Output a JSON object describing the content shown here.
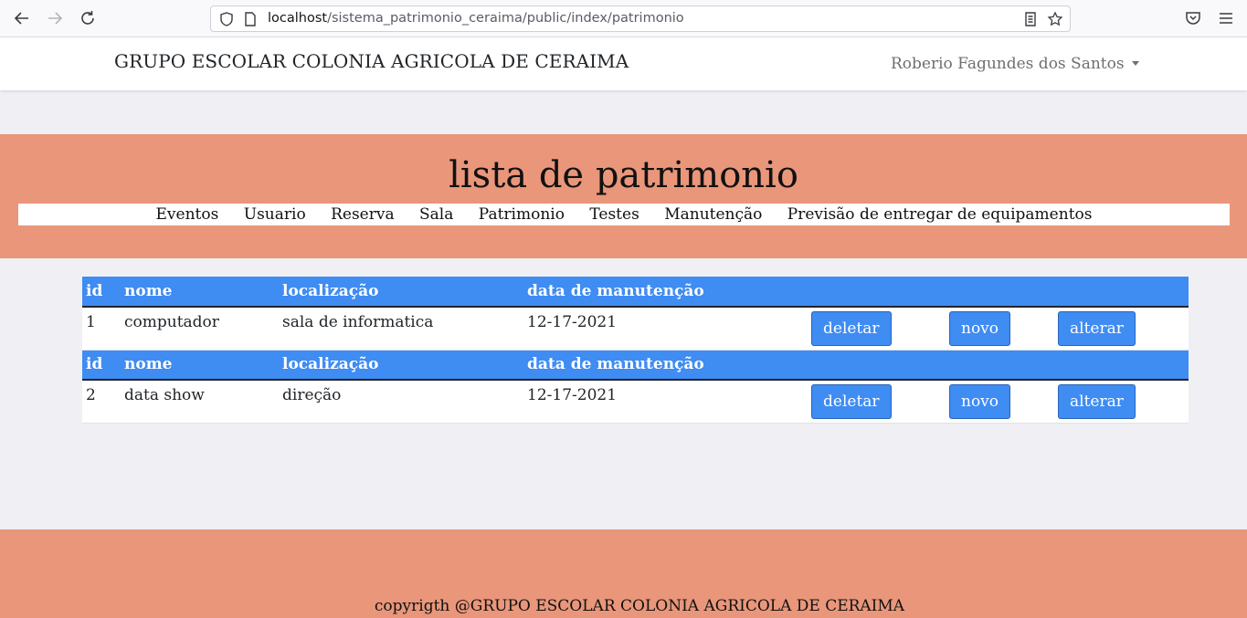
{
  "browser": {
    "url_host": "localhost",
    "url_path": "/sistema_patrimonio_ceraima/public/index/patrimonio"
  },
  "header": {
    "brand": "GRUPO ESCOLAR COLONIA AGRICOLA DE CERAIMA",
    "user": "Roberio Fagundes dos Santos"
  },
  "banner": {
    "title": "lista de patrimonio",
    "menu": [
      "Eventos",
      "Usuario",
      "Reserva",
      "Sala",
      "Patrimonio",
      "Testes",
      "Manutenção",
      "Previsão de entregar de equipamentos"
    ]
  },
  "table": {
    "columns": [
      "id",
      "nome",
      "localização",
      "data de manutenção"
    ],
    "rows": [
      {
        "id": "1",
        "nome": "computador",
        "localizacao": "sala de informatica",
        "data": "12-17-2021"
      },
      {
        "id": "2",
        "nome": "data show",
        "localizacao": "direção",
        "data": "12-17-2021"
      }
    ],
    "actions": {
      "delete": "deletar",
      "new": "novo",
      "edit": "alterar"
    }
  },
  "footer": {
    "copyright": "copyrigth @GRUPO ESCOLAR COLONIA AGRICOLA DE CERAIMA"
  },
  "colors": {
    "accent": "#e9967a",
    "primary": "#3f8cf3"
  }
}
